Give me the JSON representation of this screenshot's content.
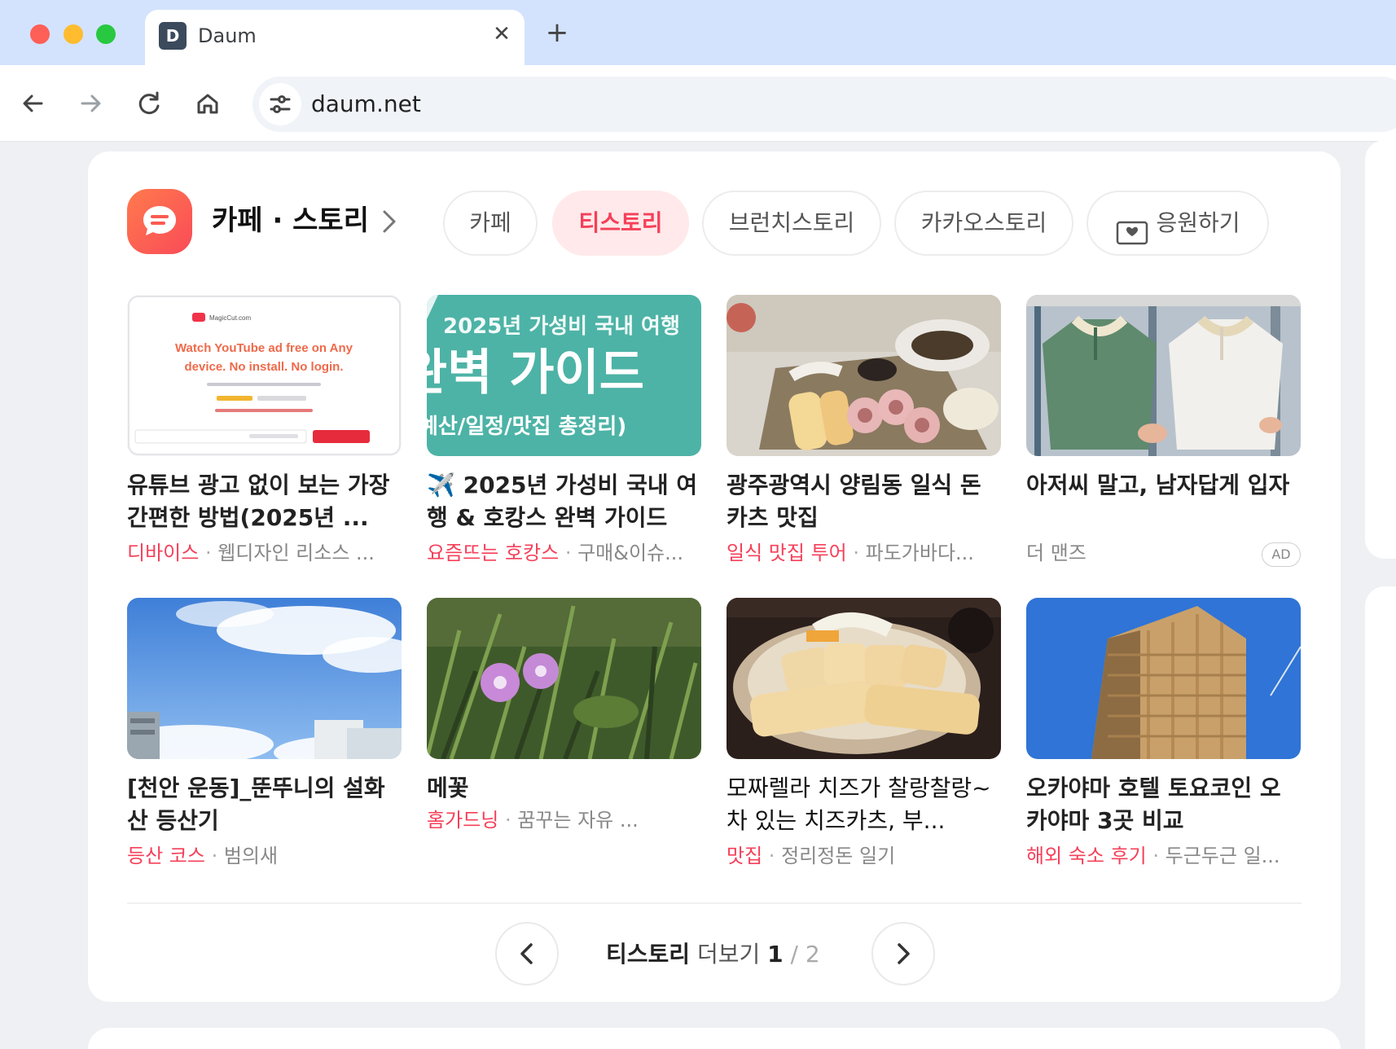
{
  "browser": {
    "tab_title": "Daum",
    "favicon_letter": "D",
    "tab_close": "✕",
    "new_tab": "+",
    "url": "daum.net"
  },
  "section": {
    "title": "카페 · 스토리",
    "tabs": [
      {
        "label": "카페",
        "active": false
      },
      {
        "label": "티스토리",
        "active": true
      },
      {
        "label": "브런치스토리",
        "active": false
      },
      {
        "label": "카카오스토리",
        "active": false
      },
      {
        "label": "응원하기",
        "active": false
      }
    ]
  },
  "posts": [
    {
      "title": "유튜브 광고 없이 보는 가장 간편한 방법(2025년 ...",
      "category": "디바이스",
      "source": "웹디자인 리소스 ...",
      "ad": false
    },
    {
      "title": "✈️ 2025년 가성비 국내 여행 & 호캉스 완벽 가이드",
      "category": "요즘뜨는 호캉스",
      "source": "구매&이슈...",
      "ad": false
    },
    {
      "title": "광주광역시 양림동 일식 돈카츠 맛집",
      "category": "일식 맛집 투어",
      "source": "파도가바다...",
      "ad": false
    },
    {
      "title": "아저씨 말고, 남자답게 입자",
      "category": "",
      "source": "더 맨즈",
      "ad": true,
      "ad_label": "AD"
    },
    {
      "title": "[천안 운동]_뚠뚜니의 설화산 등산기",
      "category": "등산 코스",
      "source": "범의새",
      "ad": false
    },
    {
      "title": "메꽃",
      "category": "홈가드닝",
      "source": "꿈꾸는 자유 ...",
      "ad": false
    },
    {
      "title": "모짜렐라 치즈가 찰랑찰랑~ 차 있는 치즈카츠, 부...",
      "category": "맛집",
      "source": "정리정돈 일기",
      "ad": false
    },
    {
      "title": "오카야마 호텔 토요코인 오카야마 3곳 비교",
      "category": "해외 숙소 후기",
      "source": "두근두근 일...",
      "ad": false
    }
  ],
  "thumbs": {
    "youtube_card": {
      "brand": "MagicCut.com",
      "headline_1": "Watch YouTube ad free on Any",
      "headline_2": "device. No install. No login."
    },
    "travel_card": {
      "line_1": "2025년 가성비 국내 여행",
      "line_2": "완벽 가이드",
      "line_3": "예산/일정/맛집 총정리)"
    }
  },
  "pager": {
    "label": "티스토리",
    "more": "더보기",
    "current": "1",
    "separator": "/",
    "total": "2"
  },
  "colors": {
    "accent": "#f5405a",
    "tab_strip": "#d3e3fd",
    "page_bg": "#eef0f3"
  },
  "icons": {
    "back": "arrow-left",
    "forward": "arrow-right",
    "reload": "reload",
    "home": "house",
    "site_info": "tune-sliders",
    "section_logo": "chat-bubble",
    "support": "gift-card"
  }
}
